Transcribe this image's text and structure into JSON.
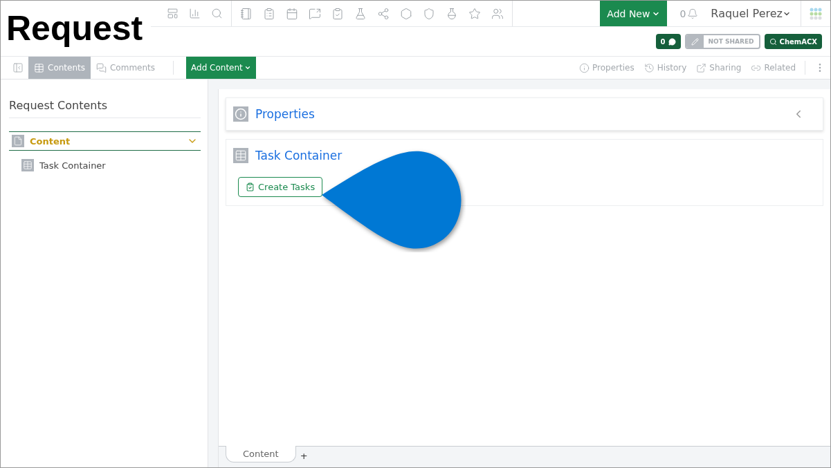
{
  "overlay_title": "Request",
  "header": {
    "add_new": "Add New",
    "notifications": "0",
    "user": "Raquel Perez"
  },
  "badges": {
    "comments": "0",
    "sharing": "NOT SHARED",
    "search": "ChemACX"
  },
  "toolbar": {
    "tabs": [
      {
        "label": "Contents",
        "selected": true
      },
      {
        "label": "Comments",
        "selected": false
      }
    ],
    "add_content": "Add Content",
    "actions": [
      "Properties",
      "History",
      "Sharing",
      "Related"
    ]
  },
  "sidebar": {
    "title": "Request Contents",
    "sections": [
      {
        "label": "Content",
        "expanded": true,
        "children": [
          {
            "label": "Task Container"
          }
        ]
      }
    ]
  },
  "panels": [
    {
      "kind": "properties",
      "title": "Properties",
      "expanded": false
    },
    {
      "kind": "tasks",
      "title": "Task Container",
      "button": "Create Tasks"
    }
  ],
  "bottom_tabs": [
    {
      "label": "Content",
      "selected": true
    }
  ],
  "add_tab": "+"
}
